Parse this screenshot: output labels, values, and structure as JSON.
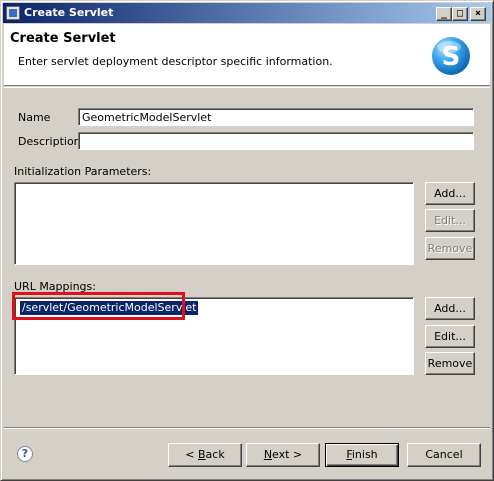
{
  "window": {
    "title": "Create Servlet",
    "controls": {
      "minimize": "_",
      "maximize": "□",
      "close": "×"
    }
  },
  "header": {
    "title": "Create Servlet",
    "description": "Enter servlet deployment descriptor specific information.",
    "logo_icon": "servlet-logo-s-icon",
    "logo_letter": "S",
    "logo_color": "#1e8ad6"
  },
  "form": {
    "name_label": "Name",
    "name_value": "GeometricModelServlet",
    "description_label": "Description",
    "description_value": ""
  },
  "init_params": {
    "label": "Initialization Parameters:",
    "items": [],
    "buttons": {
      "add": "Add...",
      "edit": "Edit...",
      "remove": "Remove"
    }
  },
  "url_mappings": {
    "label": "URL Mappings:",
    "items": [
      "/servlet/GeometricModelServlet"
    ],
    "buttons": {
      "add": "Add...",
      "edit": "Edit...",
      "remove": "Remove"
    },
    "highlight_color": "#e0101a"
  },
  "footer": {
    "help_icon": "help-question-icon",
    "help_glyph": "?",
    "back": {
      "prefix": "< ",
      "mnemonic": "B",
      "rest": "ack"
    },
    "next": {
      "mnemonic": "N",
      "rest": "ext",
      "suffix": " >"
    },
    "finish": {
      "mnemonic": "F",
      "rest": "inish"
    },
    "cancel": "Cancel"
  },
  "colors": {
    "title_gradient_start": "#0a246a",
    "title_gradient_end": "#a6caf0",
    "dialog_bg": "#d4d0c8",
    "selection_bg": "#0a246a"
  }
}
